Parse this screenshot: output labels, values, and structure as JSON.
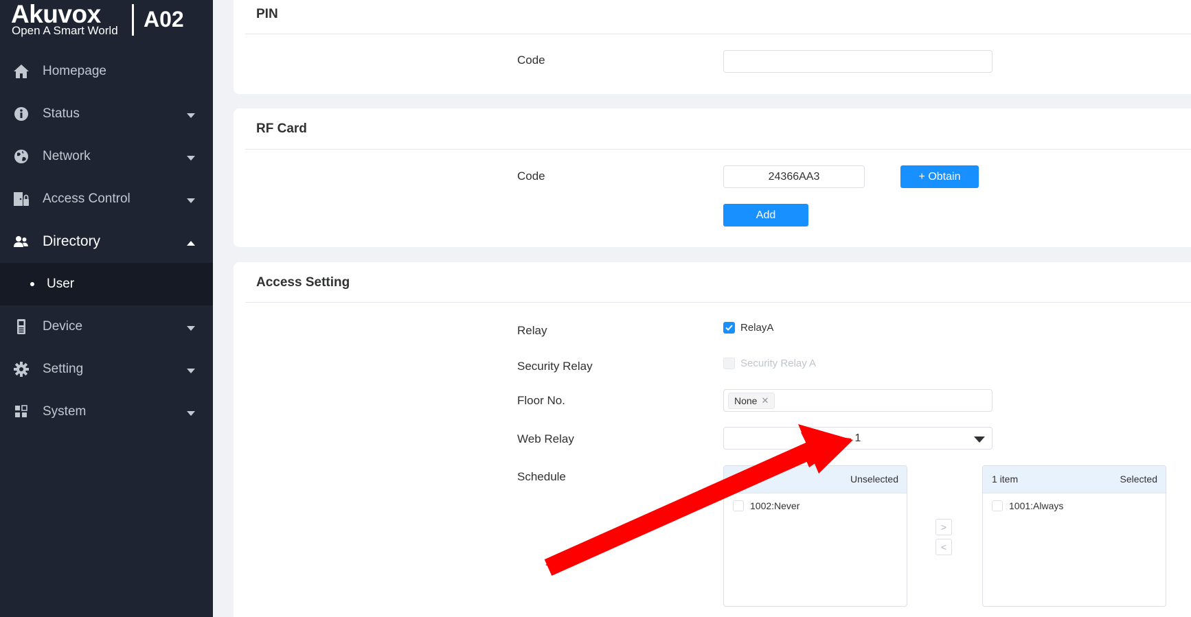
{
  "brand": {
    "name": "Akuvox",
    "tagline": "Open A Smart World",
    "model": "A02"
  },
  "sidebar": {
    "items": [
      {
        "label": "Homepage",
        "icon": "home-icon",
        "expandable": false
      },
      {
        "label": "Status",
        "icon": "info-icon",
        "expandable": true
      },
      {
        "label": "Network",
        "icon": "globe-icon",
        "expandable": true
      },
      {
        "label": "Access Control",
        "icon": "door-icon",
        "expandable": true
      },
      {
        "label": "Directory",
        "icon": "users-icon",
        "expandable": true,
        "open": true
      },
      {
        "label": "Device",
        "icon": "intercom-device-icon",
        "expandable": true
      },
      {
        "label": "Setting",
        "icon": "gear-icon",
        "expandable": true
      },
      {
        "label": "System",
        "icon": "grid-icon",
        "expandable": true
      }
    ],
    "submenu": {
      "label": "User"
    }
  },
  "pin_section": {
    "title": "PIN",
    "code_label": "Code",
    "code_value": ""
  },
  "rf_section": {
    "title": "RF Card",
    "code_label": "Code",
    "code_value": "24366AA3",
    "obtain_label": "+ Obtain",
    "add_label": "Add"
  },
  "access_section": {
    "title": "Access Setting",
    "relay_label": "Relay",
    "relay_option": "RelayA",
    "relay_checked": true,
    "security_relay_label": "Security Relay",
    "security_relay_option": "Security Relay A",
    "floor_label": "Floor No.",
    "floor_tag": "None",
    "web_relay_label": "Web Relay",
    "web_relay_value": "1",
    "schedule_label": "Schedule",
    "transfer_left": {
      "count": "1 item",
      "title": "Unselected",
      "items": [
        "1002:Never"
      ]
    },
    "transfer_right": {
      "count": "1 item",
      "title": "Selected",
      "items": [
        "1001:Always"
      ]
    },
    "move_right": ">",
    "move_left": "<"
  },
  "colors": {
    "sidebar_bg": "#1f2433",
    "primary": "#1890ff",
    "annotation": "#ff0000"
  }
}
